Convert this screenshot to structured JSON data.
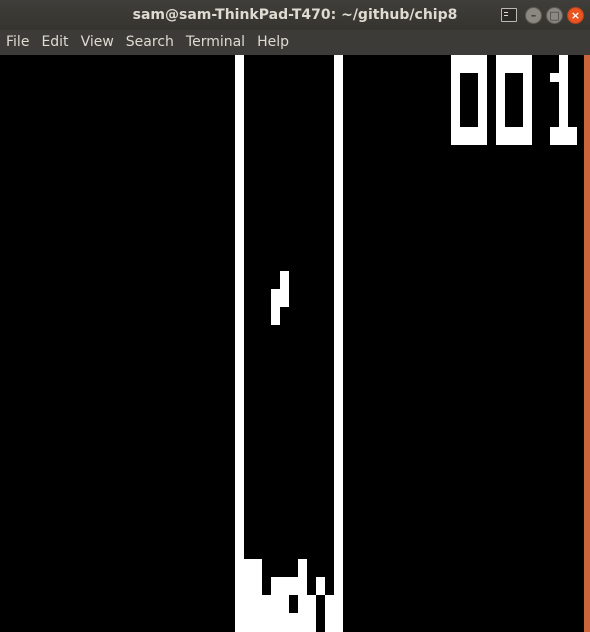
{
  "window": {
    "title": "sam@sam-ThinkPad-T470: ~/github/chip8"
  },
  "title_buttons": {
    "minimize_glyph": "–",
    "maximize_glyph": "□",
    "close_glyph": "×"
  },
  "menu": [
    "File",
    "Edit",
    "View",
    "Search",
    "Terminal",
    "Help"
  ],
  "game": {
    "score": "001",
    "colors": {
      "on": "#ffffff",
      "off": "#000000",
      "accent": "#e95420"
    }
  }
}
